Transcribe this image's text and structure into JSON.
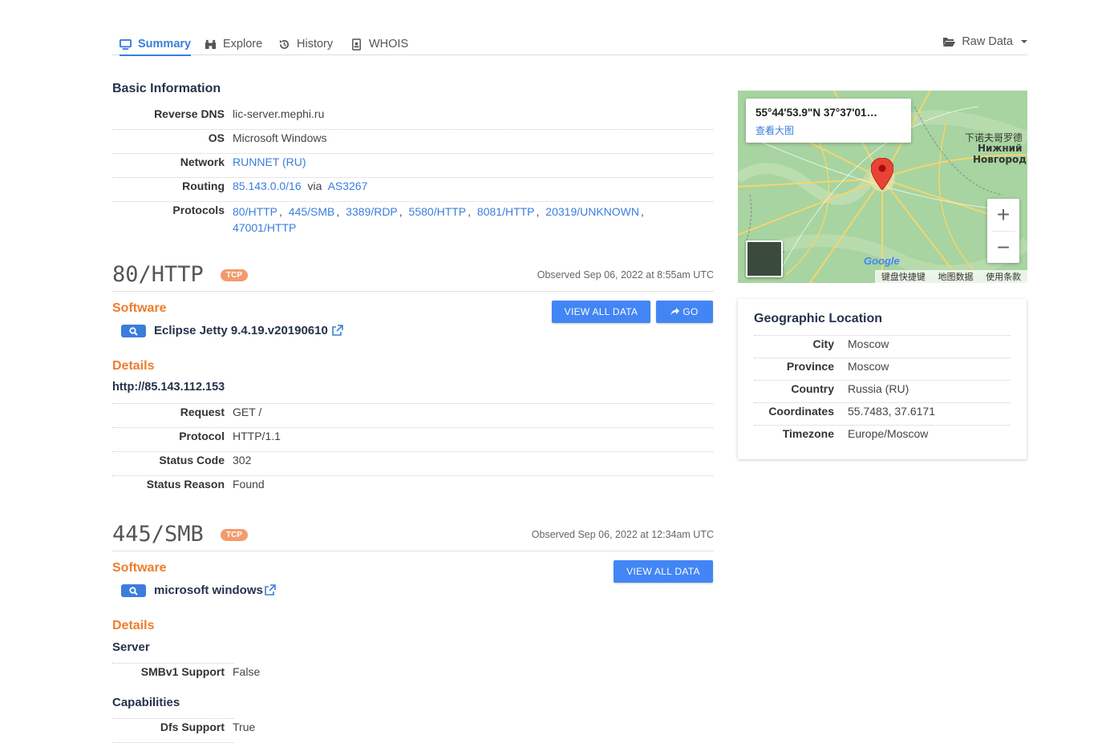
{
  "tabs": [
    {
      "label": "Summary",
      "icon": "monitor-icon"
    },
    {
      "label": "Explore",
      "icon": "binoculars-icon"
    },
    {
      "label": "History",
      "icon": "history-icon"
    },
    {
      "label": "WHOIS",
      "icon": "id-badge-icon"
    }
  ],
  "raw_data_label": "Raw Data",
  "basic": {
    "title": "Basic Information",
    "reverse_dns": {
      "key": "Reverse DNS",
      "value": "lic-server.mephi.ru"
    },
    "os": {
      "key": "OS",
      "value": "Microsoft Windows"
    },
    "network": {
      "key": "Network",
      "value": "RUNNET (RU)"
    },
    "routing": {
      "key": "Routing",
      "prefix": "85.143.0.0/16",
      "via": "via",
      "asn": "AS3267"
    },
    "protocols": {
      "key": "Protocols",
      "items": [
        "80/HTTP",
        "445/SMB",
        "3389/RDP",
        "5580/HTTP",
        "8081/HTTP",
        "20319/UNKNOWN",
        "47001/HTTP"
      ]
    }
  },
  "services": [
    {
      "title": "80/HTTP",
      "transport": "TCP",
      "observed": "Observed Sep 06, 2022 at 8:55am UTC",
      "software_label": "Software",
      "software": "Eclipse Jetty 9.4.19.v20190610",
      "view_all": "VIEW ALL DATA",
      "go": "GO",
      "details_label": "Details",
      "url": "http://85.143.112.153",
      "rows": [
        {
          "key": "Request",
          "value": "GET /"
        },
        {
          "key": "Protocol",
          "value": "HTTP/1.1"
        },
        {
          "key": "Status Code",
          "value": "302"
        },
        {
          "key": "Status Reason",
          "value": "Found"
        }
      ]
    },
    {
      "title": "445/SMB",
      "transport": "TCP",
      "observed": "Observed Sep 06, 2022 at 12:34am UTC",
      "software_label": "Software",
      "software": "microsoft windows",
      "view_all": "VIEW ALL DATA",
      "details_label": "Details",
      "server_label": "Server",
      "smb_row": {
        "key": "SMBv1 Support",
        "value": "False"
      },
      "capabilities_label": "Capabilities",
      "dfs_row": {
        "key": "Dfs Support",
        "value": "True"
      }
    }
  ],
  "map": {
    "coords_label": "55°44'53.9\"N 37°37'01…",
    "view_larger": "查看大图",
    "city_label_zh": "下诺夫哥罗德",
    "city_label_ru_1": "Нижний",
    "city_label_ru_2": "Новгород",
    "google": "Google",
    "footer": [
      "键盘快捷键",
      "地图数据",
      "使用条款"
    ],
    "zoom_in": "+",
    "zoom_out": "−"
  },
  "geo": {
    "title": "Geographic Location",
    "rows": [
      {
        "key": "City",
        "value": "Moscow"
      },
      {
        "key": "Province",
        "value": "Moscow"
      },
      {
        "key": "Country",
        "value": "Russia (RU)"
      },
      {
        "key": "Coordinates",
        "value": "55.7483, 37.6171"
      },
      {
        "key": "Timezone",
        "value": "Europe/Moscow"
      }
    ]
  },
  "colors": {
    "accent": "#3b7ddd",
    "orange": "#ef7d2d",
    "button": "#4285f4",
    "tcp_badge": "#f49a6c"
  }
}
